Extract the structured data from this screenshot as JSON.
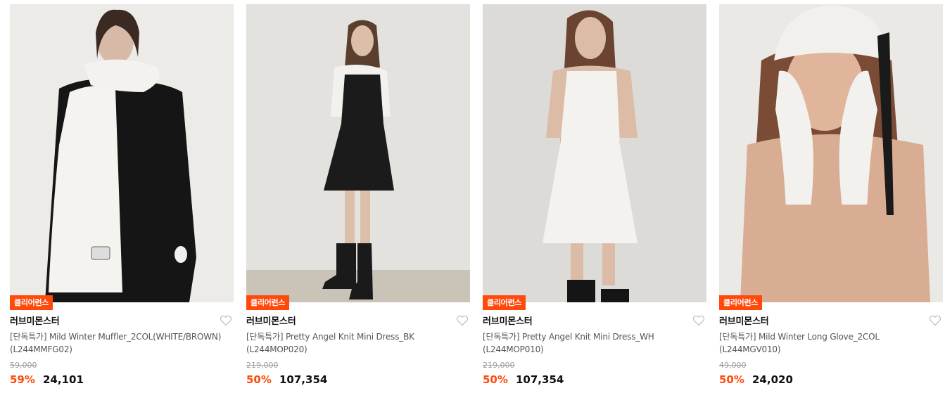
{
  "products": [
    {
      "badge": "클리어런스",
      "brand": "러브미몬스터",
      "name": "[단독특가] Mild Winter Muffler_2COL(WHITE/BROWN) (L244MMFG02)",
      "original_price": "59,000",
      "discount": "59%",
      "price": "24,101",
      "image_alt": "model in black coat with white fluffy scarf"
    },
    {
      "badge": "클리어런스",
      "brand": "러브미몬스터",
      "name": "[단독특가] Pretty Angel Knit Mini Dress_BK (L244MOP020)",
      "original_price": "219,000",
      "discount": "50%",
      "price": "107,354",
      "image_alt": "model in black knit mini dress over white turtleneck"
    },
    {
      "badge": "클리어런스",
      "brand": "러브미몬스터",
      "name": "[단독특가] Pretty Angel Knit Mini Dress_WH (L244MOP010)",
      "original_price": "219,000",
      "discount": "50%",
      "price": "107,354",
      "image_alt": "model in white knit mini dress"
    },
    {
      "badge": "클리어런스",
      "brand": "러브미몬스터",
      "name": "[단독특가] Mild Winter Long Glove_2COL (L244MGV010)",
      "original_price": "49,000",
      "discount": "50%",
      "price": "24,020",
      "image_alt": "model wearing white knit beanie and long gloves"
    }
  ],
  "colors": {
    "accent": "#ff4a0c",
    "text": "#111111",
    "muted": "#9a9a9a"
  }
}
